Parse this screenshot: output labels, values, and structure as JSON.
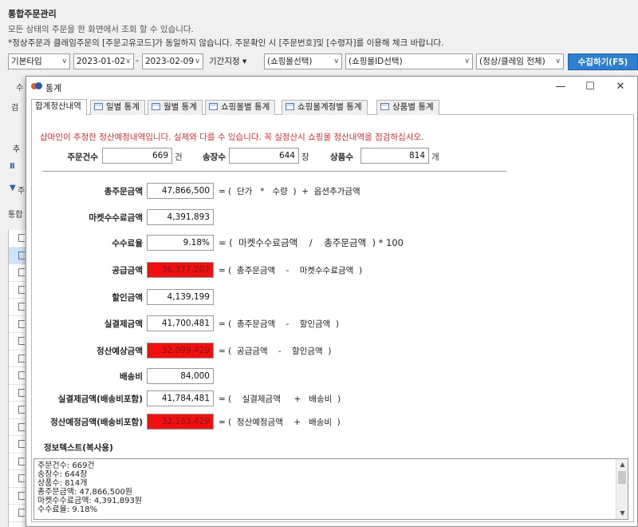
{
  "background": {
    "title": "통합주문관리",
    "line1": "모든 상태의 주문을 한 화면에서 조회 할 수 있습니다.",
    "line2": "*정상주문과 클레임주문의 [주문고유코드]가 동일하지 않습니다. 주문확인 시 [주문번호]및 [수령자]를 이용해 체크 바랍니다.",
    "type_select": "기본타입",
    "date_from": "2023-01-02",
    "date_sep": "-",
    "date_to": "2023-02-09",
    "period_label": "기간지정 ▾",
    "mall_select": "(쇼핑몰선택)",
    "mall_id_select": "(쇼핑몰ID선택)",
    "status_select": "(정상/클레임 전체)",
    "collect_button": "수집하기(F5)",
    "frag_1": "수",
    "frag_2": "검",
    "frag_3": "추",
    "frag_4": "Ⅱ",
    "frag_5": "주",
    "frag_6": "통합"
  },
  "dialog": {
    "title": "통계",
    "window_controls": {
      "minimize": "—",
      "maximize": "☐",
      "close": "✕"
    },
    "tabs": [
      {
        "label": "합계정산내역",
        "active": true
      },
      {
        "label": "일별 통계"
      },
      {
        "label": "월별 통계"
      },
      {
        "label": "쇼핑몰별 통계"
      },
      {
        "label": "쇼핑몰계정별 통계"
      },
      {
        "label": "상품별 통계"
      }
    ],
    "warning": "샵마인이 추정한 정산예정내역입니다. 실제와 다를 수 있습니다. 꼭 실정산시 쇼핑몰 정산내역을 점검하십시오.",
    "summary": {
      "order_count": {
        "label": "주문건수",
        "value": "669",
        "unit": "건"
      },
      "invoice_count": {
        "label": "송장수",
        "value": "644",
        "unit": "장"
      },
      "product_count": {
        "label": "상품수",
        "value": "814",
        "unit": "개"
      }
    },
    "rows": [
      {
        "label": "총주문금액",
        "value": "47,866,500",
        "highlight": false,
        "formula": "= (  단가   *   수량  )  +  옵션추가금액"
      },
      {
        "label": "마켓수수료금액",
        "value": "4,391,893",
        "highlight": false,
        "formula": ""
      },
      {
        "label": "수수료율",
        "value": "9.18%",
        "highlight": false,
        "formula": "= (  마켓수수료금액    /    총주문금액  ) * 100"
      },
      {
        "label": "공급금액",
        "value": "36,377,207",
        "highlight": true,
        "formula": "= (  총주문금액    -    마켓수수료금액  )"
      },
      {
        "label": "할인금액",
        "value": "4,139,199",
        "highlight": false,
        "formula": ""
      },
      {
        "label": "실결제금액",
        "value": "41,700,481",
        "highlight": false,
        "formula": "= (  총주문금액    -    할인금액  )"
      },
      {
        "label": "정산예상금액",
        "value": "32,099,429",
        "highlight": true,
        "formula": "= (  공급금액    -    할인금액  )"
      },
      {
        "label": "배송비",
        "value": "84,000",
        "highlight": false,
        "formula": ""
      },
      {
        "label": "실결제금액(배송비포함)",
        "value": "41,784,481",
        "highlight": false,
        "formula": "= (    실결제금액     +   배송비  )"
      },
      {
        "label": "정산예정금액(배송비포함)",
        "value": "32,183,429",
        "highlight": true,
        "formula": "= (  정산예정금액    +   배송비  )"
      }
    ],
    "info_title": "정보텍스트(복사용)",
    "info_lines": [
      "주문건수: 669건",
      "송장수: 644장",
      "상품수: 814개",
      "총주문금액: 47,866,500원",
      "마켓수수료금액: 4,391,893원",
      "수수료율: 9.18%"
    ]
  },
  "colors": {
    "highlight": "#f01010",
    "warning": "#d43030",
    "accent": "#2f7fd0"
  }
}
